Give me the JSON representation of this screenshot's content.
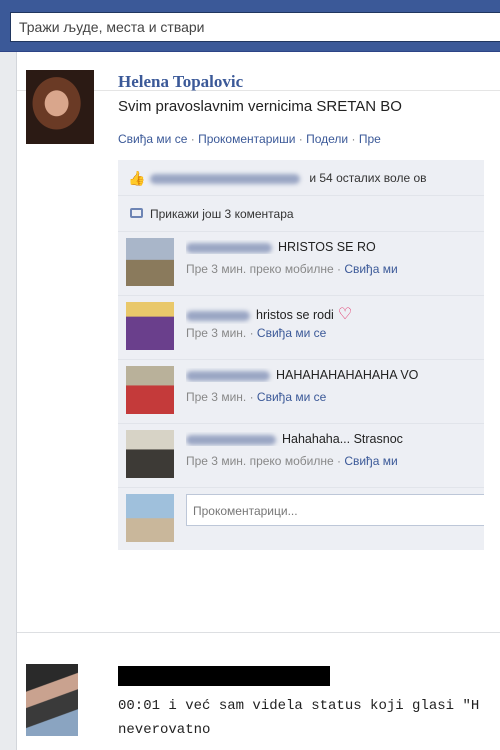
{
  "search": {
    "placeholder": "Тражи људе, места и ствари"
  },
  "post": {
    "author": "Helena Topalovic",
    "text": "Svim pravoslavnim vernicima SRETAN BO",
    "actions": [
      "Свиђа ми се",
      "Прокоментариши",
      "Подели",
      "Пре"
    ],
    "separator": "·",
    "likes_text": "и 54 осталих воле ов",
    "more_comments": "Прикажи још 3 коментара",
    "comments": [
      {
        "text": "HRISTOS SE RO",
        "time": "Пре 3 мин.",
        "via": "преко мобилне",
        "like": "Свиђа ми"
      },
      {
        "text": "hristos se rodi",
        "time": "Пре 3 мин.",
        "like": "Свиђа ми се"
      },
      {
        "text": "HAHAHAHAHAHAHA VO",
        "time": "Пре 3 мин.",
        "like": "Свиђа ми се"
      },
      {
        "text": "Hahahaha... Strasnoc",
        "time": "Пре 3 мин.",
        "via": "преко мобилне",
        "like": "Свиђа ми"
      }
    ],
    "reply_placeholder": "Прокоментарици..."
  },
  "post2": {
    "line1": "00:01 i već sam videla status koji glasi \"H",
    "line2": "neverovatno"
  },
  "colors": {
    "brand": "#3b5998",
    "link": "#3b5998",
    "background": "#e9ebee"
  },
  "icons": [
    "thumbs-up-icon",
    "comment-bubble-icon",
    "heart-icon"
  ]
}
